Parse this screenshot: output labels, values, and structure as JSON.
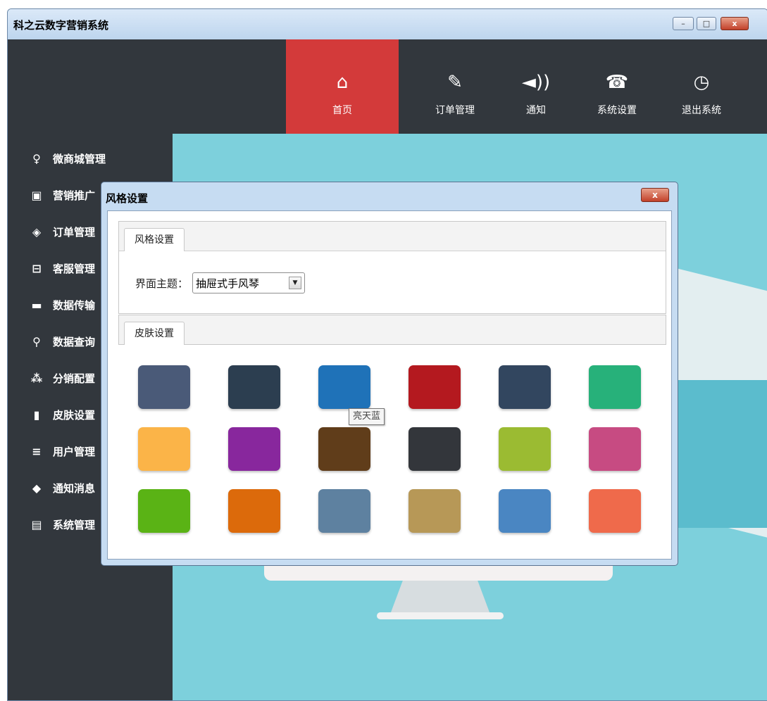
{
  "window": {
    "title": "科之云数字营销系统",
    "minimize": "–",
    "maximize": "□",
    "close": "x"
  },
  "topnav": [
    {
      "label": "首页",
      "icon": "home-icon",
      "glyph": "⌂",
      "active": true
    },
    {
      "label": "订单管理",
      "icon": "edit-icon",
      "glyph": "✎",
      "active": false
    },
    {
      "label": "通知",
      "icon": "speaker-icon",
      "glyph": "◄))",
      "active": false
    },
    {
      "label": "系统设置",
      "icon": "telephone-icon",
      "glyph": "☎",
      "active": false
    },
    {
      "label": "退出系统",
      "icon": "clock-icon",
      "glyph": "◷",
      "active": false
    }
  ],
  "sidebar": [
    {
      "label": "微商城管理",
      "icon": "microphone-icon",
      "glyph": "♀"
    },
    {
      "label": "营销推广",
      "icon": "dashboard-icon",
      "glyph": "▣"
    },
    {
      "label": "订单管理",
      "icon": "tag-icon",
      "glyph": "◈"
    },
    {
      "label": "客服管理",
      "icon": "cart-icon",
      "glyph": "⊟"
    },
    {
      "label": "数据传输",
      "icon": "truck-icon",
      "glyph": "▬"
    },
    {
      "label": "数据查询",
      "icon": "search-icon",
      "glyph": "⚲"
    },
    {
      "label": "分销配置",
      "icon": "network-icon",
      "glyph": "⁂"
    },
    {
      "label": "皮肤设置",
      "icon": "bar-chart-icon",
      "glyph": "▮"
    },
    {
      "label": "用户管理",
      "icon": "list-icon",
      "glyph": "≡"
    },
    {
      "label": "通知消息",
      "icon": "chat-icon",
      "glyph": "◆"
    },
    {
      "label": "系统管理",
      "icon": "layout-icon",
      "glyph": "▤"
    }
  ],
  "dialog": {
    "title": "风格设置",
    "close": "x",
    "style_group": {
      "tab": "风格设置",
      "theme_label": "界面主题：",
      "theme_value": "抽屉式手风琴",
      "arrow": "▼"
    },
    "skin_group": {
      "tab": "皮肤设置",
      "swatches": [
        "#4a5a78",
        "#2c3e50",
        "#1f72b8",
        "#b4191f",
        "#32465f",
        "#27b17a",
        "#fbb448",
        "#88279d",
        "#603d1a",
        "#33363b",
        "#9bbb32",
        "#c74b82",
        "#5ab315",
        "#dc6a0b",
        "#5e81a0",
        "#b79857",
        "#4a86c2",
        "#ef6a4b"
      ],
      "tooltip": "亮天蓝"
    }
  }
}
